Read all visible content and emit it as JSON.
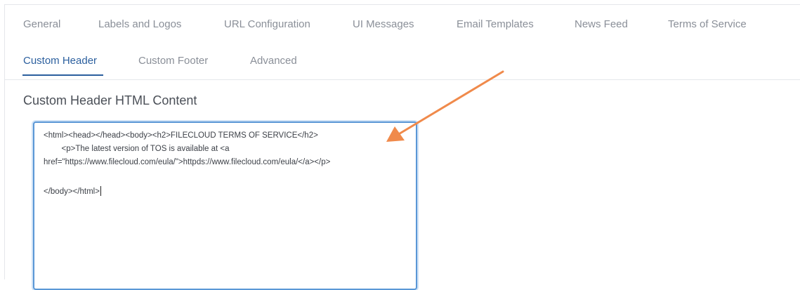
{
  "tabs_row1": [
    "General",
    "Labels and Logos",
    "URL Configuration",
    "UI Messages",
    "Email Templates",
    "News Feed",
    "Terms of Service"
  ],
  "tabs_row2": [
    "Custom Header",
    "Custom Footer",
    "Advanced"
  ],
  "active_tab": "Custom Header",
  "section_title": "Custom Header HTML Content",
  "editor_lines": [
    "<html><head></head><body><h2>FILECLOUD TERMS OF SERVICE</h2>",
    "        <p>The latest version of TOS is available at <a",
    "href=\"https://www.filecloud.com/eula/\">httpds://www.filecloud.com/eula/</a></p>",
    "",
    "</body></html>"
  ],
  "colors": {
    "accent": "#2b5f9e",
    "tab_inactive": "#8a8f98",
    "editor_border": "#5a97d6",
    "annotation_arrow": "#f08a4b"
  },
  "icons": {
    "annotation": "arrow-annotation-icon"
  }
}
